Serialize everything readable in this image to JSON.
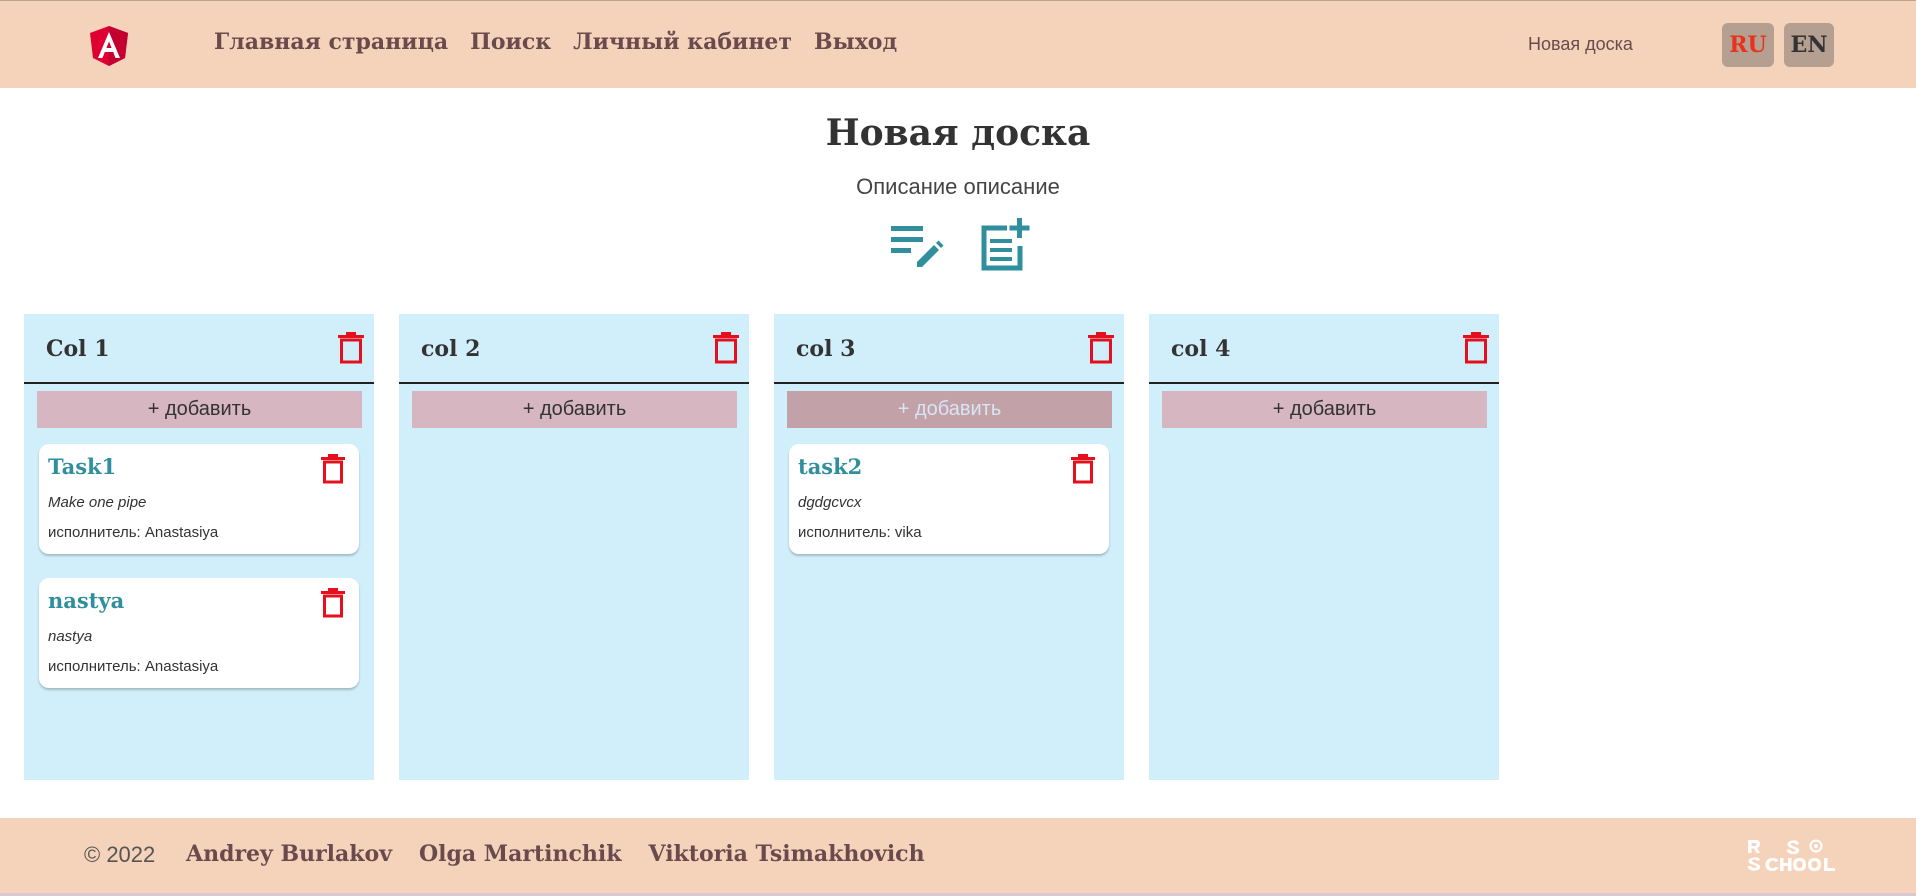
{
  "header": {
    "nav": [
      "Главная страница",
      "Поиск",
      "Личный кабинет",
      "Выход"
    ],
    "board_link": "Новая доска",
    "lang_ru": "RU",
    "lang_en": "EN"
  },
  "board": {
    "title": "Новая доска",
    "description": "Описание описание"
  },
  "columns": [
    {
      "title": "Col 1",
      "add_label": "+ добавить",
      "tasks": [
        {
          "title": "Task1",
          "description": "Make one pipe",
          "assignee": "исполнитель: Anastasiya"
        },
        {
          "title": "nastya",
          "description": "nastya",
          "assignee": "исполнитель: Anastasiya"
        }
      ]
    },
    {
      "title": "col 2",
      "add_label": "+ добавить",
      "tasks": []
    },
    {
      "title": "col 3",
      "add_label": "+ добавить",
      "tasks": [
        {
          "title": "task2",
          "description": "dgdgcvcx",
          "assignee": "исполнитель: vika"
        }
      ]
    },
    {
      "title": "col 4",
      "add_label": "+ добавить",
      "tasks": []
    }
  ],
  "footer": {
    "copyright": "© 2022",
    "authors": [
      "Andrey Burlakov",
      "Olga Martinchik",
      "Viktoria Tsimakhovich"
    ]
  },
  "colors": {
    "header_bg": "#f4d3ba",
    "column_bg": "#d1eefb",
    "accent_teal": "#2f8f9d",
    "delete_red": "#e5101c",
    "add_button": "#d6b6c0"
  },
  "icons": {
    "logo": "angular-logo-icon",
    "edit_board": "edit-notes-icon",
    "add_column": "post-add-icon",
    "delete": "trash-icon",
    "footer_logo": "rs-school-logo"
  }
}
